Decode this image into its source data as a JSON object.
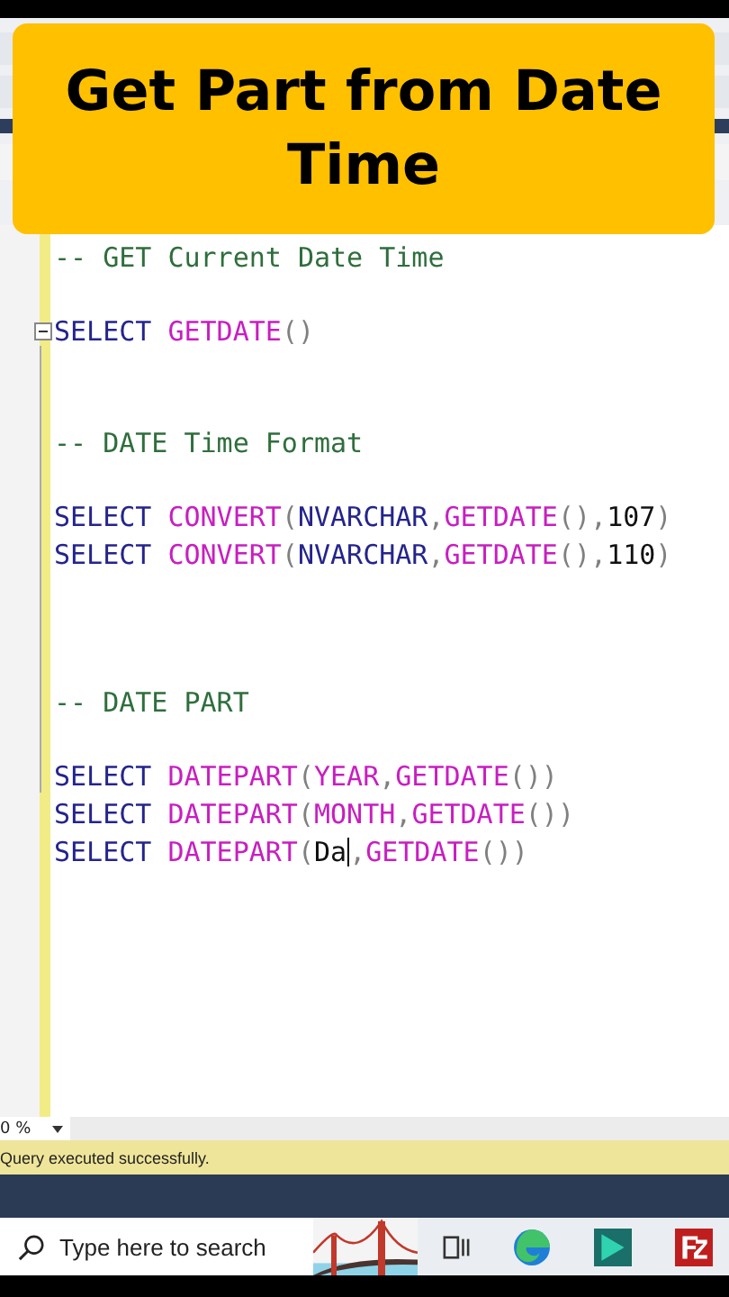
{
  "banner": {
    "title": "Get Part from Date Time"
  },
  "editor": {
    "lines": [
      {
        "kind": "code",
        "tokens": [
          {
            "kind": "comment",
            "text": "-- GET Current Date Time"
          }
        ]
      },
      {
        "kind": "blank"
      },
      {
        "kind": "code",
        "collapsible": true,
        "tokens": [
          {
            "kind": "keyword",
            "text": "SELECT "
          },
          {
            "kind": "function",
            "text": "GETDATE"
          },
          {
            "kind": "punct",
            "text": "()"
          }
        ]
      },
      {
        "kind": "blank"
      },
      {
        "kind": "blank"
      },
      {
        "kind": "code",
        "tokens": [
          {
            "kind": "comment",
            "text": "-- DATE Time Format"
          }
        ]
      },
      {
        "kind": "blank"
      },
      {
        "kind": "code",
        "tokens": [
          {
            "kind": "keyword",
            "text": "SELECT "
          },
          {
            "kind": "function",
            "text": "CONVERT"
          },
          {
            "kind": "punct",
            "text": "("
          },
          {
            "kind": "keyword",
            "text": "NVARCHAR"
          },
          {
            "kind": "punct",
            "text": ","
          },
          {
            "kind": "function",
            "text": "GETDATE"
          },
          {
            "kind": "punct",
            "text": "(),"
          },
          {
            "kind": "ident",
            "text": "107"
          },
          {
            "kind": "punct",
            "text": ")"
          }
        ]
      },
      {
        "kind": "code",
        "tokens": [
          {
            "kind": "keyword",
            "text": "SELECT "
          },
          {
            "kind": "function",
            "text": "CONVERT"
          },
          {
            "kind": "punct",
            "text": "("
          },
          {
            "kind": "keyword",
            "text": "NVARCHAR"
          },
          {
            "kind": "punct",
            "text": ","
          },
          {
            "kind": "function",
            "text": "GETDATE"
          },
          {
            "kind": "punct",
            "text": "(),"
          },
          {
            "kind": "ident",
            "text": "110"
          },
          {
            "kind": "punct",
            "text": ")"
          }
        ]
      },
      {
        "kind": "blank"
      },
      {
        "kind": "blank"
      },
      {
        "kind": "blank"
      },
      {
        "kind": "code",
        "tokens": [
          {
            "kind": "comment",
            "text": "-- DATE PART"
          }
        ]
      },
      {
        "kind": "blank"
      },
      {
        "kind": "code",
        "tokens": [
          {
            "kind": "keyword",
            "text": "SELECT "
          },
          {
            "kind": "function",
            "text": "DATEPART"
          },
          {
            "kind": "punct",
            "text": "("
          },
          {
            "kind": "function",
            "text": "YEAR"
          },
          {
            "kind": "punct",
            "text": ","
          },
          {
            "kind": "function",
            "text": "GETDATE"
          },
          {
            "kind": "punct",
            "text": "())"
          }
        ]
      },
      {
        "kind": "code",
        "tokens": [
          {
            "kind": "keyword",
            "text": "SELECT "
          },
          {
            "kind": "function",
            "text": "DATEPART"
          },
          {
            "kind": "punct",
            "text": "("
          },
          {
            "kind": "function",
            "text": "MONTH"
          },
          {
            "kind": "punct",
            "text": ","
          },
          {
            "kind": "function",
            "text": "GETDATE"
          },
          {
            "kind": "punct",
            "text": "())"
          }
        ]
      },
      {
        "kind": "code",
        "tokens": [
          {
            "kind": "keyword",
            "text": "SELECT "
          },
          {
            "kind": "function",
            "text": "DATEPART"
          },
          {
            "kind": "punct",
            "text": "("
          },
          {
            "kind": "ident",
            "text": "Da"
          },
          {
            "kind": "caret"
          },
          {
            "kind": "punct",
            "text": ","
          },
          {
            "kind": "function",
            "text": "GETDATE"
          },
          {
            "kind": "punct",
            "text": "())"
          }
        ]
      }
    ]
  },
  "zoom": {
    "value": "0 %"
  },
  "status_bar": {
    "message": "Query executed successfully."
  },
  "taskbar": {
    "search": {
      "placeholder": "Type here to search"
    }
  }
}
